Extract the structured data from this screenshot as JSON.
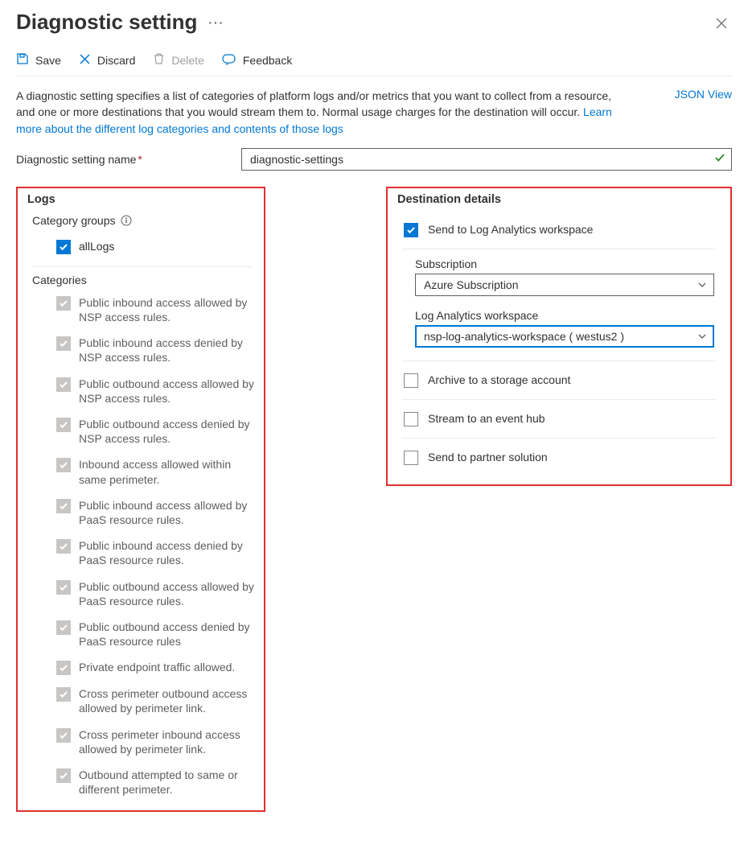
{
  "header": {
    "title": "Diagnostic setting",
    "ellipsis": "···"
  },
  "toolbar": {
    "save": "Save",
    "discard": "Discard",
    "delete": "Delete",
    "feedback": "Feedback"
  },
  "description": {
    "text_part1": "A diagnostic setting specifies a list of categories of platform logs and/or metrics that you want to collect from a resource, and one or more destinations that you would stream them to. Normal usage charges for the destination will occur. ",
    "learn_link": "Learn more about the different log categories and contents of those logs",
    "json_view": "JSON View"
  },
  "name_field": {
    "label": "Diagnostic setting name",
    "value": "diagnostic-settings"
  },
  "logs_panel": {
    "title": "Logs",
    "category_groups_label": "Category groups",
    "allLogs_label": "allLogs",
    "categories_label": "Categories",
    "categories": [
      "Public inbound access allowed by NSP access rules.",
      "Public inbound access denied by NSP access rules.",
      "Public outbound access allowed by NSP access rules.",
      "Public outbound access denied by NSP access rules.",
      "Inbound access allowed within same perimeter.",
      "Public inbound access allowed by PaaS resource rules.",
      "Public inbound access denied by PaaS resource rules.",
      "Public outbound access allowed by PaaS resource rules.",
      "Public outbound access denied by PaaS resource rules",
      "Private endpoint traffic allowed.",
      "Cross perimeter outbound access allowed by perimeter link.",
      "Cross perimeter inbound access allowed by perimeter link.",
      "Outbound attempted to same or different perimeter."
    ]
  },
  "dest_panel": {
    "title": "Destination details",
    "send_law_label": "Send to Log Analytics workspace",
    "subscription_label": "Subscription",
    "subscription_value": "Azure Subscription",
    "workspace_label": "Log Analytics workspace",
    "workspace_value": "nsp-log-analytics-workspace ( westus2 )",
    "archive_label": "Archive to a storage account",
    "eventhub_label": "Stream to an event hub",
    "partner_label": "Send to partner solution"
  }
}
